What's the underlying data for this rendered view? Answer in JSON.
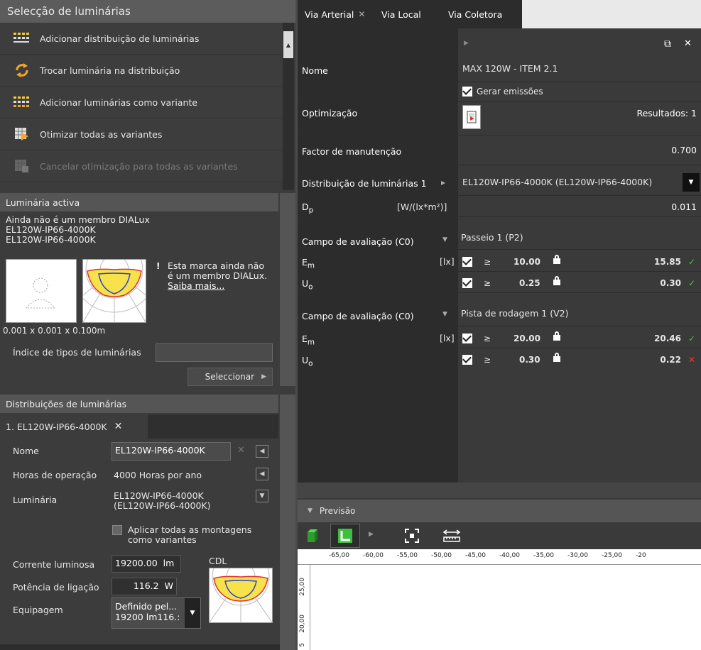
{
  "left": {
    "title": "Selecção de luminárias",
    "actions": [
      {
        "label": "Adicionar distribuição de luminárias",
        "icon": "grid-icon",
        "disabled": false
      },
      {
        "label": "Trocar luminária na distribuição",
        "icon": "swap-icon",
        "disabled": false
      },
      {
        "label": "Adicionar luminárias como variante",
        "icon": "variants-icon",
        "disabled": false
      },
      {
        "label": "Otimizar todas as variantes",
        "icon": "optimize-icon",
        "disabled": false
      },
      {
        "label": "Cancelar otimização para todas as variantes",
        "icon": "cancel-optimize-icon",
        "disabled": true
      }
    ],
    "active_luminaire": {
      "header": "Luminária activa",
      "line1": "Ainda não é um membro DIALux",
      "line2": "EL120W-IP66-4000K",
      "line3": "EL120W-IP66-4000K",
      "brand_notice_1": "Esta marca ainda não",
      "brand_notice_2": "é um membro DIALux.",
      "learn_more": "Saiba mais...",
      "dimensions": "0.001 x 0.001 x 0.100m",
      "type_index_label": "Índice de tipos de luminárias",
      "type_index_value": "",
      "select_button": "Seleccionar"
    },
    "distributions": {
      "header": "Distribuições de luminárias",
      "tab": "1. EL120W-IP66-4000K",
      "name_label": "Nome",
      "name_value": "EL120W-IP66-4000K",
      "hours_label": "Horas de operação",
      "hours_value": "4000 Horas por ano",
      "luminaire_label": "Luminária",
      "luminaire_value_1": "EL120W-IP66-4000K",
      "luminaire_value_2": "(EL120W-IP66-4000K)",
      "apply_all_1": "Aplicar todas as montagens",
      "apply_all_2": "como variantes",
      "flux_label": "Corrente luminosa",
      "flux_value": "19200.00",
      "flux_unit": "lm",
      "cdl_label": "CDL",
      "power_label": "Potência de ligação",
      "power_value": "116.2",
      "power_unit": "W",
      "equip_label": "Equipagem",
      "equip_value_1": "Definido pel...",
      "equip_value_2": "19200 lm116.:"
    }
  },
  "right": {
    "tabs": [
      {
        "label": "Via Arterial",
        "active": true,
        "closable": true
      },
      {
        "label": "Via Local",
        "active": false,
        "closable": false
      },
      {
        "label": "Via Coletora",
        "active": false,
        "closable": false
      }
    ],
    "props": {
      "name_label": "Nome",
      "name_value": "MAX 120W - ITEM 2.1",
      "gen_emissions": "Gerar emissões",
      "opt_label": "Optimização",
      "results": "Resultados: 1",
      "maint_label": "Factor de manutenção",
      "maint_value": "0.700",
      "dist_label": "Distribuição de luminárias 1",
      "dist_value": "EL120W-IP66-4000K (EL120W-IP66-4000K)",
      "dp_label": "D",
      "dp_sub": "p",
      "dp_unit": "[W/(lx*m²)]",
      "dp_value": "0.011",
      "field1_label": "Campo de avaliação (C0)",
      "field1_value": "Passeio 1 (P2)",
      "em1_label": "E",
      "em1_sub": "m",
      "em1_unit": "[lx]",
      "em1_req": "10.00",
      "em1_res": "15.85",
      "uo1_label": "U",
      "uo1_sub": "o",
      "uo1_req": "0.25",
      "uo1_res": "0.30",
      "field2_label": "Campo de avaliação (C0)",
      "field2_value": "Pista de rodagem 1 (V2)",
      "em2_label": "E",
      "em2_sub": "m",
      "em2_unit": "[lx]",
      "em2_req": "20.00",
      "em2_res": "20.46",
      "uo2_label": "U",
      "uo2_sub": "o",
      "uo2_req": "0.30",
      "uo2_res": "0.22",
      "geq": "≥"
    },
    "preview": {
      "title": "Previsão",
      "ruler_x": [
        "-65,00",
        "-60,00",
        "-55,00",
        "-50,00",
        "-45,00",
        "-40,00",
        "-35,00",
        "-30,00",
        "-25,00",
        "-20"
      ],
      "ruler_y": [
        "25,00",
        "20,00",
        "5"
      ]
    }
  },
  "colors": {
    "ok": "#4cc04c",
    "fail": "#e23c3c",
    "link": "#ffffff"
  }
}
